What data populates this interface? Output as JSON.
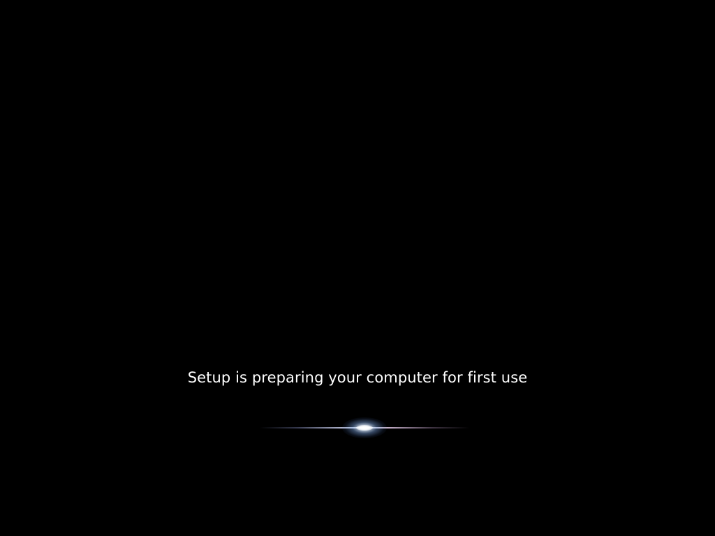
{
  "setup": {
    "status_message": "Setup is preparing your computer for first use"
  },
  "colors": {
    "background": "#000000",
    "text": "#ffffff",
    "glow_accent": "#9fb6e6"
  },
  "icons": {
    "progress_glow": "light-streak-icon"
  }
}
